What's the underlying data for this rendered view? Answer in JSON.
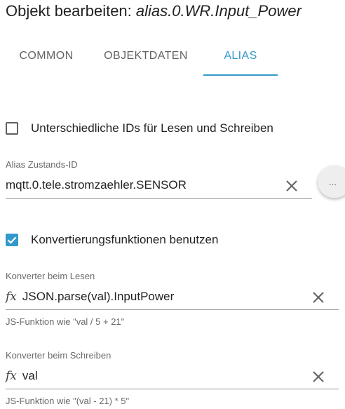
{
  "dialog": {
    "title_prefix": "Objekt bearbeiten: ",
    "object_id": "alias.0.WR.Input_Power"
  },
  "tabs": [
    {
      "label": "COMMON",
      "active": false
    },
    {
      "label": "OBJEKTDATEN",
      "active": false
    },
    {
      "label": "ALIAS",
      "active": true
    }
  ],
  "accent_color": "#3399cc",
  "separate_ids": {
    "label": "Unterschiedliche IDs für Lesen und Schreiben",
    "checked": false
  },
  "alias_state": {
    "label": "Alias Zustands-ID",
    "value": "mqtt.0.tele.stromzaehler.SENSOR",
    "more_label": "..."
  },
  "use_conversion": {
    "label": "Konvertierungsfunktionen benutzen",
    "checked": true
  },
  "read_converter": {
    "label": "Konverter beim Lesen",
    "icon": "fx",
    "value": "JSON.parse(val).InputPower",
    "helper": "JS-Funktion wie \"val / 5 + 21\""
  },
  "write_converter": {
    "label": "Konverter beim Schreiben",
    "icon": "fx",
    "value": "val",
    "helper": "JS-Funktion wie \"(val - 21) * 5\""
  }
}
